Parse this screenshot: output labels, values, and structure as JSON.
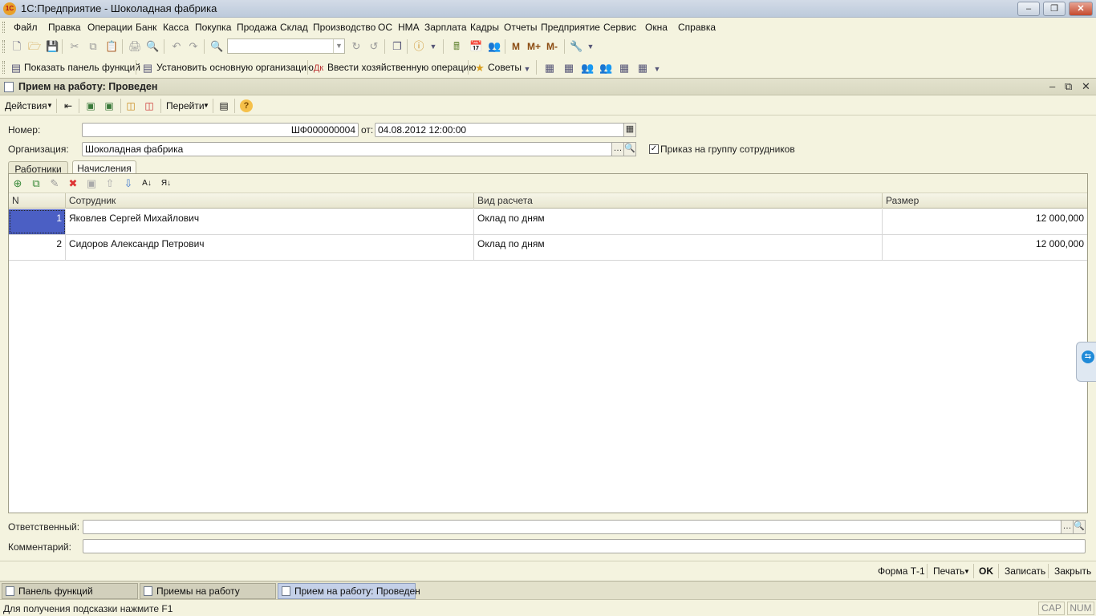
{
  "window": {
    "title": "1С:Предприятие - Шоколадная фабрика",
    "icon_text": "1С",
    "controls": [
      "minimize-icon",
      "restore-icon",
      "close-icon"
    ]
  },
  "menu": [
    "Файл",
    "Правка",
    "Операции",
    "Банк",
    "Касса",
    "Покупка",
    "Продажа",
    "Склад",
    "Производство",
    "ОС",
    "НМА",
    "Зарплата",
    "Кадры",
    "Отчеты",
    "Предприятие",
    "Сервис",
    "Окна",
    "Справка"
  ],
  "toolbar2": {
    "show_panel": "Показать панель функций",
    "set_org": "Установить основную организацию",
    "enter_op": "Ввести хозяйственную операцию",
    "tips": "Советы",
    "m_buttons": [
      "M",
      "M+",
      "M-"
    ]
  },
  "document": {
    "title": "Прием на работу: Проведен",
    "actions_label": "Действия",
    "goto_label": "Перейти",
    "number_label": "Номер:",
    "number_value": "ШФ000000004",
    "date_label": "от:",
    "date_value": "04.08.2012 12:00:00",
    "org_label": "Организация:",
    "org_value": "Шоколадная фабрика",
    "group_order_label": "Приказ на группу сотрудников",
    "group_order_checked": true,
    "tabs": [
      "Работники",
      "Начисления"
    ],
    "active_tab": "Начисления",
    "table": {
      "columns": [
        "N",
        "Сотрудник",
        "Вид расчета",
        "Размер"
      ],
      "rows": [
        {
          "n": "1",
          "employee": "Яковлев Сергей Михайлович",
          "calc": "Оклад по дням",
          "amount": "12 000,000"
        },
        {
          "n": "2",
          "employee": "Сидоров Александр Петрович",
          "calc": "Оклад по дням",
          "amount": "12 000,000"
        }
      ]
    },
    "responsible_label": "Ответственный:",
    "responsible_value": "",
    "comment_label": "Комментарий:",
    "comment_value": "",
    "footer": {
      "form": "Форма Т-1",
      "print": "Печать",
      "ok": "OK",
      "save": "Записать",
      "close": "Закрыть"
    }
  },
  "taskbar": [
    "Панель функций",
    "Приемы на работу",
    "Прием на работу: Проведен"
  ],
  "status": {
    "hint": "Для получения подсказки нажмите F1",
    "cap": "CAP",
    "num": "NUM"
  }
}
